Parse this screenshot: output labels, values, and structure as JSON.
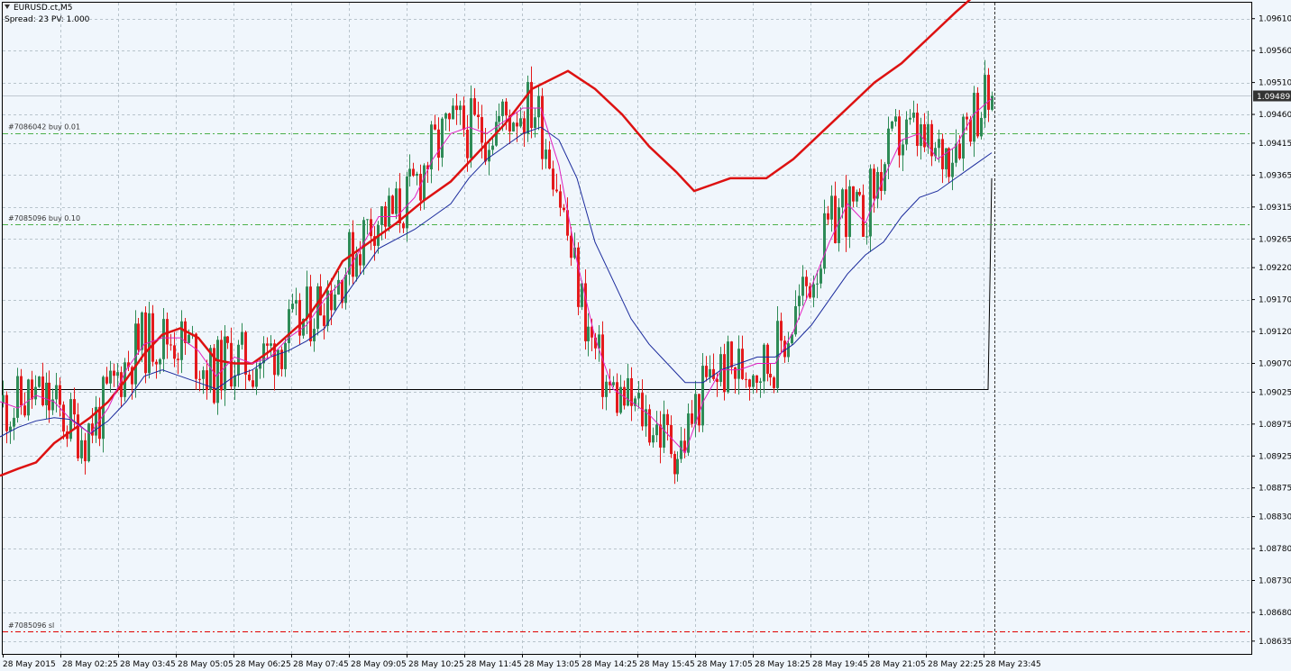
{
  "header": {
    "symbol": "EURUSD.ct,M5",
    "info": "Spread: 23   PV: 1.000"
  },
  "colors": {
    "background": "#f0f6fc",
    "grid": "#b8c4cc",
    "bull_candle": "#2e8b57",
    "bear_candle": "#e41a1c",
    "ma_fast": "#e020c0",
    "ma_mid": "#1a2a9c",
    "ma_slow": "#dd1111",
    "order_line": "#4bb04b",
    "sl_line": "#e00000"
  },
  "chart_data": {
    "type": "candlestick",
    "ylim": [
      1.08615,
      1.09635
    ],
    "price_ticks": [
      "1.09610",
      "1.09560",
      "1.09510",
      "1.09460",
      "1.09415",
      "1.09365",
      "1.09315",
      "1.09265",
      "1.09220",
      "1.09170",
      "1.09120",
      "1.09070",
      "1.09025",
      "1.08975",
      "1.08925",
      "1.08875",
      "1.08830",
      "1.08780",
      "1.08730",
      "1.08680",
      "1.08635"
    ],
    "time_labels": [
      "28 May 2015",
      "28 May 02:25",
      "28 May 03:45",
      "28 May 05:05",
      "28 May 06:25",
      "28 May 07:45",
      "28 May 09:05",
      "28 May 10:25",
      "28 May 11:45",
      "28 May 13:05",
      "28 May 14:25",
      "28 May 15:45",
      "28 May 17:05",
      "28 May 18:25",
      "28 May 19:45",
      "28 May 21:05",
      "28 May 22:25",
      "28 May 23:45"
    ],
    "current_price": "1.09489",
    "current_value": 1.09489,
    "orders": [
      {
        "label": "#7086042 buy 0.01",
        "price": 1.09431
      },
      {
        "label": "#7085096 buy 0.10",
        "price": 1.09288
      }
    ],
    "stop_loss": {
      "label": "#7085096 sl",
      "price": 1.0865
    },
    "horizontal_line": 1.0903,
    "num_bars": 278,
    "ma_slow": [
      [
        0,
        1.08894
      ],
      [
        20,
        1.08905
      ],
      [
        40,
        1.08915
      ],
      [
        60,
        1.08945
      ],
      [
        80,
        1.08965
      ],
      [
        100,
        1.08985
      ],
      [
        120,
        1.0901
      ],
      [
        140,
        1.09045
      ],
      [
        160,
        1.09085
      ],
      [
        180,
        1.09115
      ],
      [
        200,
        1.09125
      ],
      [
        220,
        1.0911
      ],
      [
        240,
        1.09075
      ],
      [
        260,
        1.0907
      ],
      [
        280,
        1.0907
      ],
      [
        300,
        1.0909
      ],
      [
        320,
        1.09115
      ],
      [
        340,
        1.0914
      ],
      [
        360,
        1.0918
      ],
      [
        380,
        1.0923
      ],
      [
        410,
        1.0926
      ],
      [
        440,
        1.0929
      ],
      [
        470,
        1.09325
      ],
      [
        500,
        1.09355
      ],
      [
        530,
        1.094
      ],
      [
        560,
        1.09445
      ],
      [
        590,
        1.095
      ],
      [
        630,
        1.09528
      ],
      [
        660,
        1.095
      ],
      [
        690,
        1.0946
      ],
      [
        720,
        1.0941
      ],
      [
        750,
        1.0937
      ],
      [
        770,
        1.0934
      ],
      [
        790,
        1.0935
      ],
      [
        810,
        1.0936
      ],
      [
        850,
        1.0936
      ],
      [
        880,
        1.0939
      ],
      [
        910,
        1.0943
      ],
      [
        940,
        1.0947
      ],
      [
        970,
        1.0951
      ],
      [
        1000,
        1.0954
      ],
      [
        1030,
        1.0958
      ],
      [
        1060,
        1.0962
      ],
      [
        1080,
        1.09645
      ],
      [
        1100,
        1.09668
      ]
    ],
    "ma_mid": [
      [
        0,
        1.08955
      ],
      [
        20,
        1.0897
      ],
      [
        40,
        1.0898
      ],
      [
        60,
        1.08985
      ],
      [
        80,
        1.08982
      ],
      [
        100,
        1.0896
      ],
      [
        120,
        1.0898
      ],
      [
        140,
        1.0901
      ],
      [
        160,
        1.0905
      ],
      [
        180,
        1.0906
      ],
      [
        200,
        1.0905
      ],
      [
        220,
        1.0904
      ],
      [
        240,
        1.0903
      ],
      [
        260,
        1.0905
      ],
      [
        280,
        1.0906
      ],
      [
        300,
        1.0908
      ],
      [
        320,
        1.0909
      ],
      [
        340,
        1.09105
      ],
      [
        360,
        1.09125
      ],
      [
        380,
        1.0917
      ],
      [
        400,
        1.0921
      ],
      [
        420,
        1.0925
      ],
      [
        440,
        1.09265
      ],
      [
        460,
        1.0928
      ],
      [
        480,
        1.093
      ],
      [
        500,
        1.0932
      ],
      [
        520,
        1.0936
      ],
      [
        540,
        1.0939
      ],
      [
        560,
        1.0941
      ],
      [
        580,
        1.0943
      ],
      [
        600,
        1.0944
      ],
      [
        620,
        1.0942
      ],
      [
        640,
        1.0936
      ],
      [
        660,
        1.0926
      ],
      [
        680,
        1.092
      ],
      [
        700,
        1.0914
      ],
      [
        720,
        1.091
      ],
      [
        740,
        1.0907
      ],
      [
        760,
        1.0904
      ],
      [
        780,
        1.0904
      ],
      [
        800,
        1.0906
      ],
      [
        820,
        1.0907
      ],
      [
        840,
        1.0908
      ],
      [
        860,
        1.0908
      ],
      [
        880,
        1.091
      ],
      [
        900,
        1.0913
      ],
      [
        920,
        1.0917
      ],
      [
        940,
        1.0921
      ],
      [
        960,
        1.0924
      ],
      [
        980,
        1.0926
      ],
      [
        1000,
        1.093
      ],
      [
        1020,
        1.0933
      ],
      [
        1040,
        1.0934
      ],
      [
        1060,
        1.0936
      ],
      [
        1080,
        1.0938
      ],
      [
        1100,
        1.094
      ]
    ],
    "ma_fast": [
      [
        0,
        1.0901
      ],
      [
        20,
        1.09
      ],
      [
        40,
        1.0902
      ],
      [
        60,
        1.0901
      ],
      [
        80,
        1.0898
      ],
      [
        100,
        1.0896
      ],
      [
        120,
        1.09
      ],
      [
        140,
        1.0906
      ],
      [
        160,
        1.091
      ],
      [
        180,
        1.0911
      ],
      [
        200,
        1.0911
      ],
      [
        220,
        1.0909
      ],
      [
        240,
        1.0905
      ],
      [
        260,
        1.0908
      ],
      [
        280,
        1.0907
      ],
      [
        300,
        1.0908
      ],
      [
        320,
        1.0911
      ],
      [
        340,
        1.0913
      ],
      [
        360,
        1.0917
      ],
      [
        380,
        1.092
      ],
      [
        400,
        1.0925
      ],
      [
        420,
        1.093
      ],
      [
        440,
        1.093
      ],
      [
        460,
        1.0933
      ],
      [
        480,
        1.0939
      ],
      [
        500,
        1.0943
      ],
      [
        520,
        1.0944
      ],
      [
        540,
        1.0943
      ],
      [
        560,
        1.0945
      ],
      [
        580,
        1.0947
      ],
      [
        600,
        1.0947
      ],
      [
        620,
        1.0938
      ],
      [
        640,
        1.0923
      ],
      [
        660,
        1.0911
      ],
      [
        680,
        1.0903
      ],
      [
        700,
        1.0901
      ],
      [
        720,
        1.0899
      ],
      [
        740,
        1.0896
      ],
      [
        760,
        1.0893
      ],
      [
        780,
        1.0901
      ],
      [
        800,
        1.0906
      ],
      [
        820,
        1.0906
      ],
      [
        840,
        1.0907
      ],
      [
        860,
        1.0907
      ],
      [
        880,
        1.0912
      ],
      [
        900,
        1.0919
      ],
      [
        920,
        1.0926
      ],
      [
        940,
        1.0932
      ],
      [
        960,
        1.0929
      ],
      [
        980,
        1.0936
      ],
      [
        1000,
        1.0942
      ],
      [
        1020,
        1.0943
      ],
      [
        1040,
        1.0939
      ],
      [
        1060,
        1.0941
      ],
      [
        1080,
        1.0946
      ],
      [
        1100,
        1.09485
      ]
    ]
  }
}
